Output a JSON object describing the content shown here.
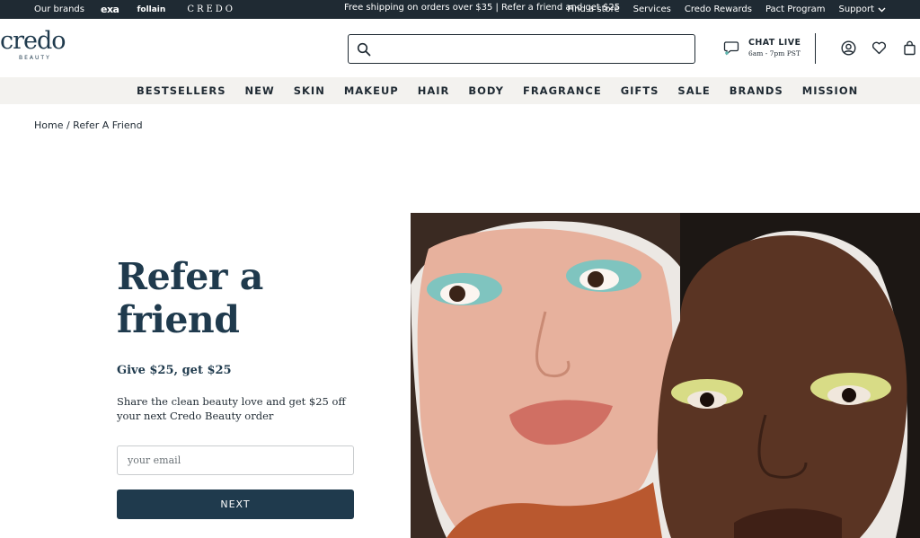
{
  "topbar": {
    "our_brands": "Our brands",
    "brand_exa": "exa",
    "brand_follain": "follain",
    "brand_credo": "CREDO",
    "promo": "Free shipping on orders over $35 | Refer a friend and get $25",
    "links": [
      "Find a store",
      "Services",
      "Credo Rewards",
      "Pact Program"
    ],
    "support": "Support"
  },
  "header": {
    "logo_word": "credo",
    "logo_sub": "BEAUTY",
    "search_placeholder": "",
    "chat_title": "CHAT LIVE",
    "chat_hours": "6am - 7pm PST"
  },
  "nav": {
    "items": [
      "BESTSELLERS",
      "NEW",
      "SKIN",
      "MAKEUP",
      "HAIR",
      "BODY",
      "FRAGRANCE",
      "GIFTS",
      "SALE",
      "BRANDS",
      "MISSION"
    ]
  },
  "breadcrumb": "Home / Refer A Friend",
  "hero": {
    "title": "Refer a friend",
    "subtitle": "Give $25, get $25",
    "description": "Share the clean beauty love and get $25 off your next Credo Beauty order",
    "email_placeholder": "your email",
    "next_label": "NEXT"
  },
  "icons": {
    "search": "search-icon",
    "chat": "chat-bubble-icon",
    "account": "user-account-icon",
    "wishlist": "heart-icon",
    "bag": "shopping-bag-icon",
    "support_caret": "chevron-down-icon"
  },
  "colors": {
    "brand_navy": "#1f3a4d",
    "topbar_bg": "#1f2a33",
    "nav_bg": "#f3f2ef",
    "button_bg": "#1f3a4d"
  }
}
